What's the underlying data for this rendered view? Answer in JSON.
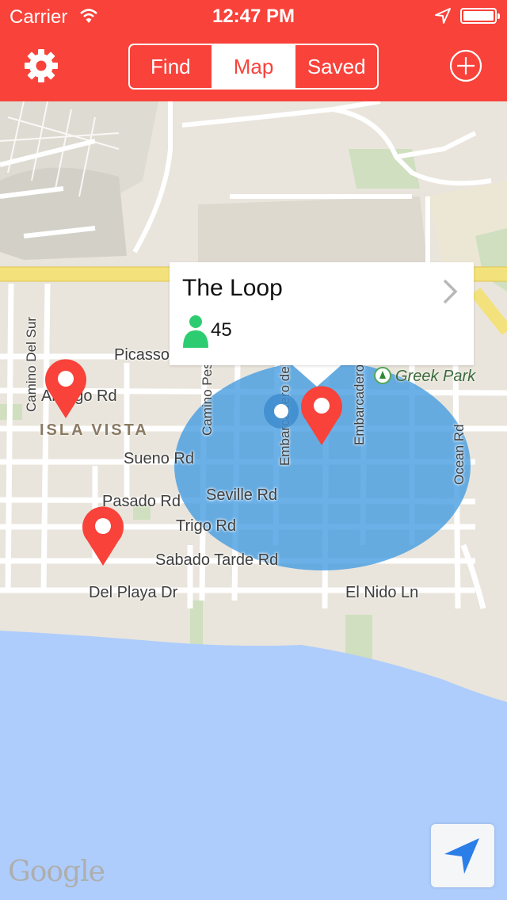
{
  "status_bar": {
    "carrier": "Carrier",
    "time": "12:47 PM"
  },
  "nav": {
    "tabs": [
      {
        "label": "Find"
      },
      {
        "label": "Map",
        "active": true
      },
      {
        "label": "Saved"
      }
    ],
    "left_icon": "gear-icon",
    "right_icon": "plus-circle-icon"
  },
  "colors": {
    "accent": "#f8423a",
    "water": "#aecdfc",
    "land": "#e9e5dc",
    "radius": "#419be1",
    "person": "#2ecc71"
  },
  "map": {
    "roads": {
      "picasso": "Picasso",
      "abrego": "Abrego Rd",
      "sueno": "Sueno Rd",
      "pasado": "Pasado Rd",
      "seville": "Seville Rd",
      "trigo": "Trigo Rd",
      "sabado_tarde": "Sabado Tarde Rd",
      "del_playa": "Del Playa Dr",
      "el_nido": "El Nido Ln",
      "camino_del_sur": "Camino Del Sur",
      "camino_pescadero": "Camino Pescadero",
      "embarcadero_del_mar": "Embarcadero del Mar",
      "embarcadero_del_norte": "Embarcadero del Norte",
      "ocean": "Ocean Rd"
    },
    "area": "ISLA VISTA",
    "park": "Greek Park",
    "attribution": "Google"
  },
  "callout": {
    "title": "The Loop",
    "count": "45"
  }
}
